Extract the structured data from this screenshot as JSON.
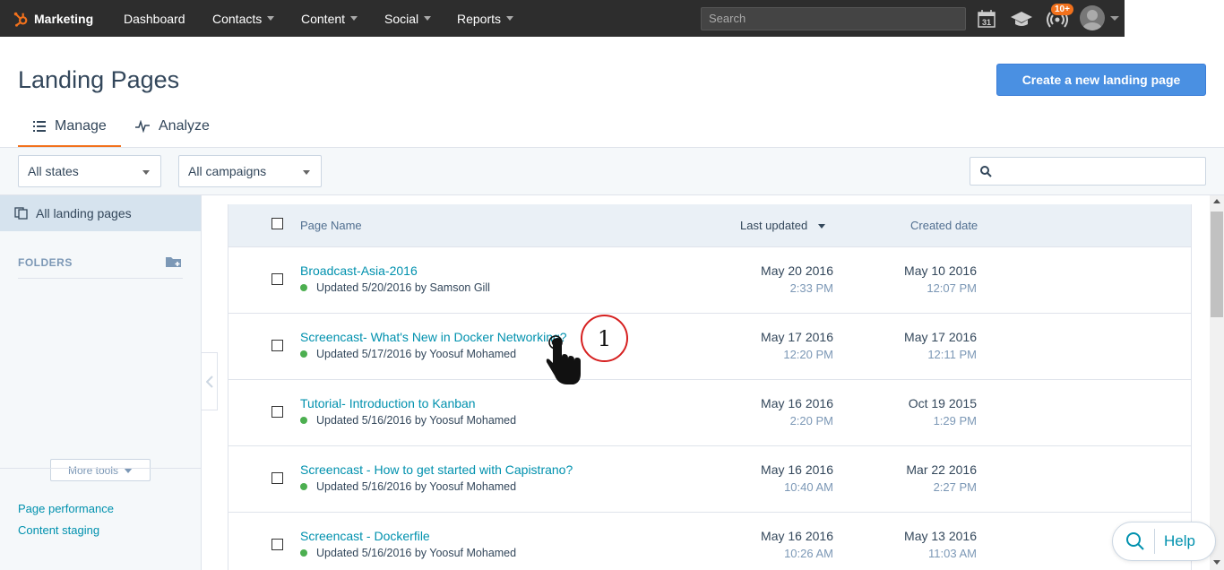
{
  "nav": {
    "brand": "Marketing",
    "items": [
      "Dashboard",
      "Contacts",
      "Content",
      "Social",
      "Reports"
    ],
    "search_placeholder": "Search",
    "calendar_day": "31",
    "notifications_badge": "10+"
  },
  "header": {
    "title": "Landing Pages",
    "create_button": "Create a new landing page",
    "tabs": [
      {
        "label": "Manage",
        "active": true
      },
      {
        "label": "Analyze",
        "active": false
      }
    ]
  },
  "filters": {
    "state_select": "All states",
    "campaign_select": "All campaigns"
  },
  "sidebar": {
    "all_pages": "All landing pages",
    "folders_label": "FOLDERS",
    "more_tools": "More tools",
    "links": [
      "Page performance",
      "Content staging"
    ]
  },
  "table": {
    "columns": {
      "name": "Page Name",
      "last_updated": "Last updated",
      "created": "Created date"
    },
    "rows": [
      {
        "name": "Broadcast-Asia-2016",
        "status": "Updated 5/20/2016 by Samson Gill",
        "updated_date": "May 20 2016",
        "updated_time": "2:33 PM",
        "created_date": "May 10 2016",
        "created_time": "12:07 PM"
      },
      {
        "name": "Screencast- What's New in Docker Networking?",
        "status": "Updated 5/17/2016 by Yoosuf Mohamed",
        "updated_date": "May 17 2016",
        "updated_time": "12:20 PM",
        "created_date": "May 17 2016",
        "created_time": "12:11 PM"
      },
      {
        "name": "Tutorial- Introduction to Kanban",
        "status": "Updated 5/16/2016 by Yoosuf Mohamed",
        "updated_date": "May 16 2016",
        "updated_time": "2:20 PM",
        "created_date": "Oct 19 2015",
        "created_time": "1:29 PM"
      },
      {
        "name": "Screencast - How to get started with Capistrano?",
        "status": "Updated 5/16/2016 by Yoosuf Mohamed",
        "updated_date": "May 16 2016",
        "updated_time": "10:40 AM",
        "created_date": "Mar 22 2016",
        "created_time": "2:27 PM"
      },
      {
        "name": "Screencast - Dockerfile",
        "status": "Updated 5/16/2016 by Yoosuf Mohamed",
        "updated_date": "May 16 2016",
        "updated_time": "10:26 AM",
        "created_date": "May 13 2016",
        "created_time": "11:03 AM"
      }
    ]
  },
  "annotation": {
    "step": "1"
  },
  "help": {
    "label": "Help"
  },
  "colors": {
    "accent": "#f2711c",
    "primary_button": "#4a90e2",
    "link": "#0091ae",
    "status_published": "#4caf50"
  }
}
